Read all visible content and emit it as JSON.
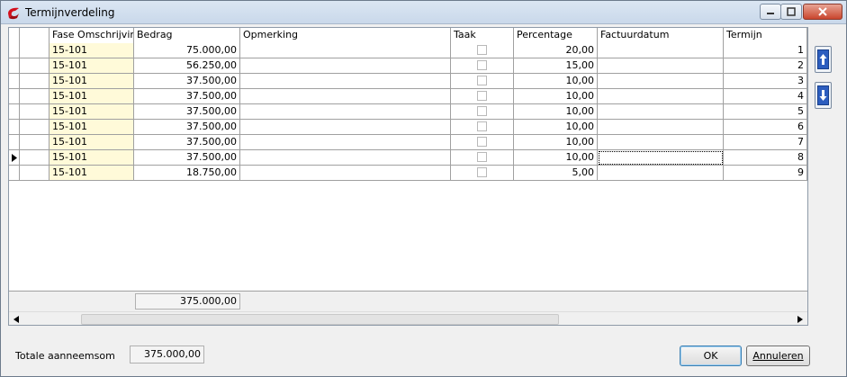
{
  "window": {
    "title": "Termijnverdeling"
  },
  "grid": {
    "columns": [
      "Fase Omschrijving",
      "Bedrag",
      "Opmerking",
      "Taak",
      "Percentage",
      "Factuurdatum",
      "Termijn"
    ],
    "rows": [
      {
        "fase": "15-101",
        "bedrag": "75.000,00",
        "opmerking": "",
        "taak": false,
        "percentage": "20,00",
        "factuurdatum": "",
        "termijn": "1"
      },
      {
        "fase": "15-101",
        "bedrag": "56.250,00",
        "opmerking": "",
        "taak": false,
        "percentage": "15,00",
        "factuurdatum": "",
        "termijn": "2"
      },
      {
        "fase": "15-101",
        "bedrag": "37.500,00",
        "opmerking": "",
        "taak": false,
        "percentage": "10,00",
        "factuurdatum": "",
        "termijn": "3"
      },
      {
        "fase": "15-101",
        "bedrag": "37.500,00",
        "opmerking": "",
        "taak": false,
        "percentage": "10,00",
        "factuurdatum": "",
        "termijn": "4"
      },
      {
        "fase": "15-101",
        "bedrag": "37.500,00",
        "opmerking": "",
        "taak": false,
        "percentage": "10,00",
        "factuurdatum": "",
        "termijn": "5"
      },
      {
        "fase": "15-101",
        "bedrag": "37.500,00",
        "opmerking": "",
        "taak": false,
        "percentage": "10,00",
        "factuurdatum": "",
        "termijn": "6"
      },
      {
        "fase": "15-101",
        "bedrag": "37.500,00",
        "opmerking": "",
        "taak": false,
        "percentage": "10,00",
        "factuurdatum": "",
        "termijn": "7"
      },
      {
        "fase": "15-101",
        "bedrag": "37.500,00",
        "opmerking": "",
        "taak": false,
        "percentage": "10,00",
        "factuurdatum": "",
        "termijn": "8",
        "current": true
      },
      {
        "fase": "15-101",
        "bedrag": "18.750,00",
        "opmerking": "",
        "taak": false,
        "percentage": "5,00",
        "factuurdatum": "",
        "termijn": "9"
      }
    ],
    "footer_total": "375.000,00"
  },
  "side_buttons": {
    "up_icon": "move-up-icon",
    "down_icon": "move-down-icon"
  },
  "bottom": {
    "total_label": "Totale aanneemsom",
    "total_value": "375.000,00",
    "ok_label": "OK",
    "cancel_label": "Annuleren"
  }
}
